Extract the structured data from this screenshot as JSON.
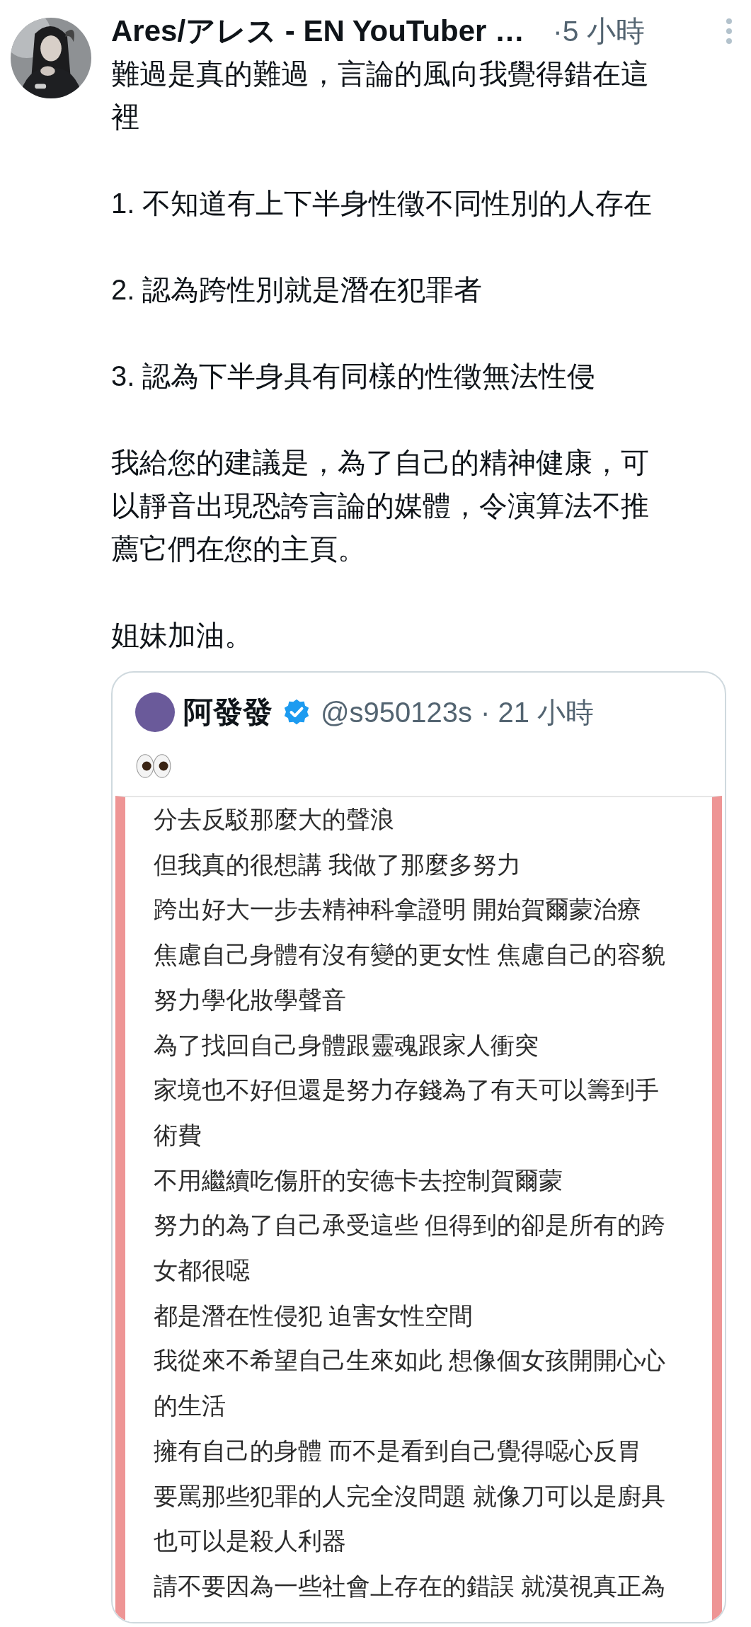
{
  "post": {
    "author": "Ares/アレス - EN YouTuber …",
    "time": "·5 小時",
    "paragraphs": [
      "難過是真的難過，言論的風向我覺得錯在這裡",
      "1. 不知道有上下半身性徵不同性別的人存在",
      "2. 認為跨性別就是潛在犯罪者",
      "3.  認為下半身具有同樣的性徵無法性侵",
      "我給您的建議是，為了自己的精神健康，可以靜音出現恐誇言論的媒體，令演算法不推薦它們在您的主頁。",
      "姐妹加油。"
    ]
  },
  "quoted_post": {
    "author": "阿發發",
    "verified": true,
    "handle": "@s950123s",
    "time": "· 21 小時",
    "image_lines": [
      "分去反駁那麼大的聲浪",
      "但我真的很想講 我做了那麼多努力",
      "跨出好大一步去精神科拿證明 開始賀爾蒙治療",
      "焦慮自己身體有沒有變的更女性 焦慮自己的容貌",
      "努力學化妝學聲音",
      "為了找回自己身體跟靈魂跟家人衝突",
      "家境也不好但還是努力存錢為了有天可以籌到手",
      "術費",
      "不用繼續吃傷肝的安德卡去控制賀爾蒙",
      "努力的為了自己承受這些 但得到的卻是所有的跨",
      "女都很噁",
      "都是潛在性侵犯 迫害女性空間",
      "我從來不希望自己生來如此 想像個女孩開開心心",
      "的生活",
      "擁有自己的身體 而不是看到自己覺得噁心反胃",
      "要罵那些犯罪的人完全沒問題 就像刀可以是廚具",
      "也可以是殺人利器",
      "請不要因為一些社會上存在的錯誤 就漠視真正為"
    ]
  }
}
